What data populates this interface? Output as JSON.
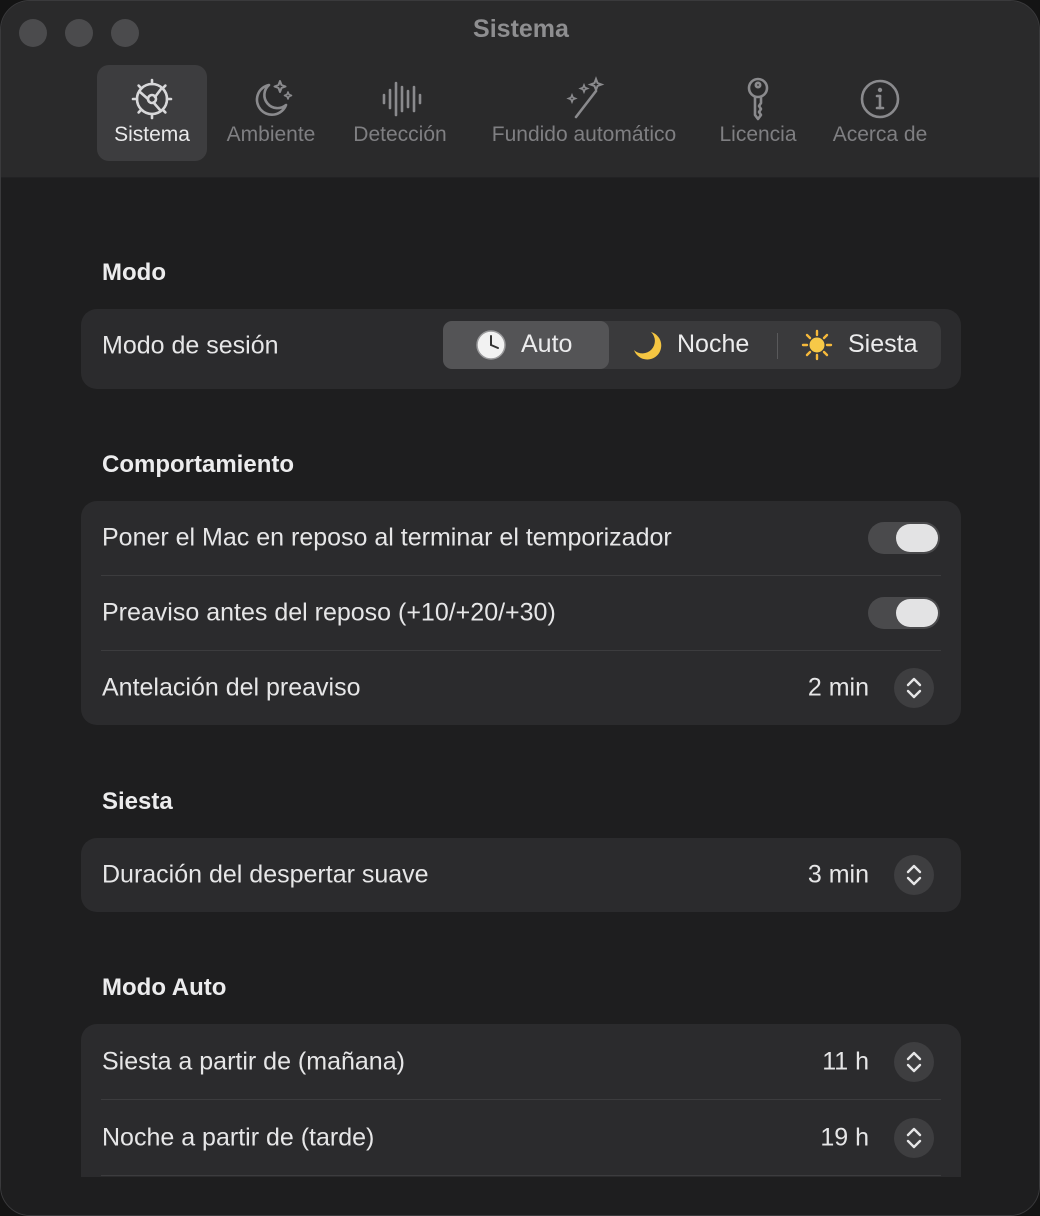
{
  "window": {
    "title": "Sistema"
  },
  "tabs": [
    {
      "label": "Sistema",
      "icon": "gear-icon",
      "active": true
    },
    {
      "label": "Ambiente",
      "icon": "moon-stars-icon",
      "active": false
    },
    {
      "label": "Detección",
      "icon": "waveform-icon",
      "active": false
    },
    {
      "label": "Fundido automático",
      "icon": "magic-wand-icon",
      "active": false
    },
    {
      "label": "Licencia",
      "icon": "key-icon",
      "active": false
    },
    {
      "label": "Acerca de",
      "icon": "info-icon",
      "active": false
    }
  ],
  "sections": {
    "modo": {
      "title": "Modo",
      "session_label": "Modo de sesión",
      "segments": [
        {
          "label": "Auto",
          "icon": "clock-icon",
          "selected": true
        },
        {
          "label": "Noche",
          "icon": "crescent-moon-icon",
          "selected": false
        },
        {
          "label": "Siesta",
          "icon": "sun-icon",
          "selected": false
        }
      ]
    },
    "comportamiento": {
      "title": "Comportamiento",
      "sleep_label": "Poner el Mac en reposo al terminar el temporizador",
      "sleep_on": true,
      "warning_label": "Preaviso antes del reposo (+10/+20/+30)",
      "warning_on": true,
      "advance_label": "Antelación del preaviso",
      "advance_value": "2 min"
    },
    "siesta": {
      "title": "Siesta",
      "wake_label": "Duración del despertar suave",
      "wake_value": "3 min"
    },
    "auto": {
      "title": "Modo Auto",
      "siesta_from_label": "Siesta a partir de (mañana)",
      "siesta_from_value": "11 h",
      "night_from_label": "Noche a partir de (tarde)",
      "night_from_value": "19 h"
    }
  },
  "colors": {
    "window_bg": "#1e1e1f",
    "card_bg": "#2b2b2d",
    "toggle_knob": "#e3e3e4"
  }
}
